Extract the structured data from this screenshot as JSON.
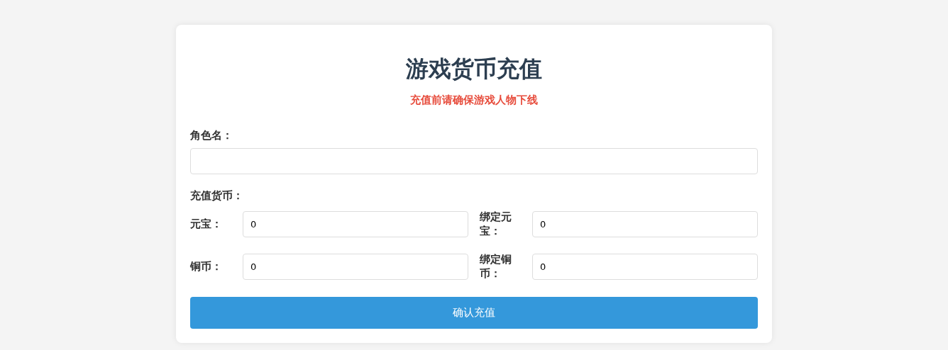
{
  "title": "游戏货币充值",
  "notice": "充值前请确保游戏人物下线",
  "role_name": {
    "label": "角色名："
  },
  "currency": {
    "label": "充值货币：",
    "fields": [
      {
        "label": "元宝：",
        "value": "0"
      },
      {
        "label": "绑定元宝：",
        "value": "0"
      },
      {
        "label": "铜币：",
        "value": "0"
      },
      {
        "label": "绑定铜币：",
        "value": "0"
      }
    ]
  },
  "submit": "确认充值"
}
